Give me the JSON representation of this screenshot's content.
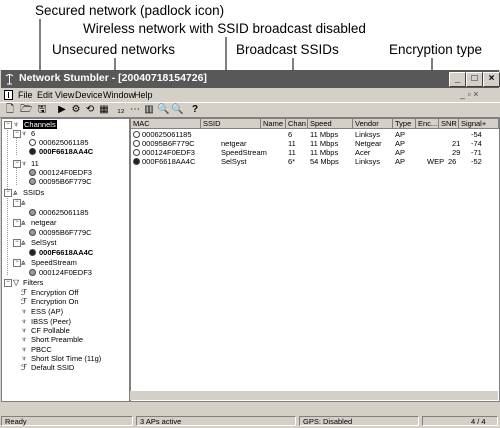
{
  "callouts": {
    "secured": "Secured network (padlock icon)",
    "wireless": "Wireless network with SSID broadcast disabled",
    "unsecured": "Unsecured networks",
    "broadcast": "Broadcast SSIDs",
    "encryption": "Encryption type"
  },
  "window": {
    "title": "Network Stumbler - [20040718154726]",
    "min": "_",
    "max": "□",
    "close": "×"
  },
  "menu": {
    "file": "File",
    "edit": "Edit",
    "view": "View",
    "device": "Device",
    "window": "Window",
    "help": "Help",
    "mdi": "_ ▫ ×"
  },
  "toolbar": [
    "🗋",
    "🗁",
    "🖫",
    "▶",
    "⚙",
    "⟲",
    "▦",
    "₁₂",
    "⋯",
    "▥",
    "🔍",
    "🔍",
    "?"
  ],
  "tree": {
    "channels": "Channels",
    "ch6": "6",
    "ch6_mac1": "000625061185",
    "ch6_mac2": "000F6618AA4C",
    "ch11": "11",
    "ch11_mac1": "000124F0EDF3",
    "ch11_mac2": "00095B6F779C",
    "ssids": "SSIDs",
    "ssid_blank_mac": "000625061185",
    "netgear": "netgear",
    "netgear_mac": "00095B6F779C",
    "selsyst": "SelSyst",
    "selsyst_mac": "000F6618AA4C",
    "speedstream": "SpeedStream",
    "speedstream_mac": "000124F0EDF3",
    "filters": "Filters",
    "filter_items": [
      "Encryption Off",
      "Encryption On",
      "ESS (AP)",
      "IBSS (Peer)",
      "CF Pollable",
      "Short Preamble",
      "PBCC",
      "Short Slot Time (11g)",
      "Default SSID"
    ]
  },
  "columns": [
    "MAC",
    "SSID",
    "Name",
    "Chan",
    "Speed",
    "Vendor",
    "Type",
    "Enc...",
    "SNR",
    "Signal+"
  ],
  "rows": [
    {
      "mac": "000625061185",
      "ssid": "",
      "name": "",
      "chan": "6",
      "speed": "11 Mbps",
      "vendor": "Linksys",
      "type": "AP",
      "enc": "",
      "snr": "",
      "signal": "-54"
    },
    {
      "mac": "00095B6F779C",
      "ssid": "netgear",
      "name": "",
      "chan": "11",
      "speed": "11 Mbps",
      "vendor": "Netgear",
      "type": "AP",
      "enc": "",
      "snr": "21",
      "signal": "-74"
    },
    {
      "mac": "000124F0EDF3",
      "ssid": "SpeedStream",
      "name": "",
      "chan": "11",
      "speed": "11 Mbps",
      "vendor": "Acer",
      "type": "AP",
      "enc": "",
      "snr": "29",
      "signal": "-71"
    },
    {
      "mac": "000F6618AA4C",
      "ssid": "SelSyst",
      "name": "",
      "chan": "6*",
      "speed": "54 Mbps",
      "vendor": "Linksys",
      "type": "AP",
      "enc": "WEP",
      "snr": "26",
      "signal": "-52"
    }
  ],
  "status": {
    "ready": "Ready",
    "active": "3 APs active",
    "gps": "GPS: Disabled",
    "count": "4 / 4"
  }
}
